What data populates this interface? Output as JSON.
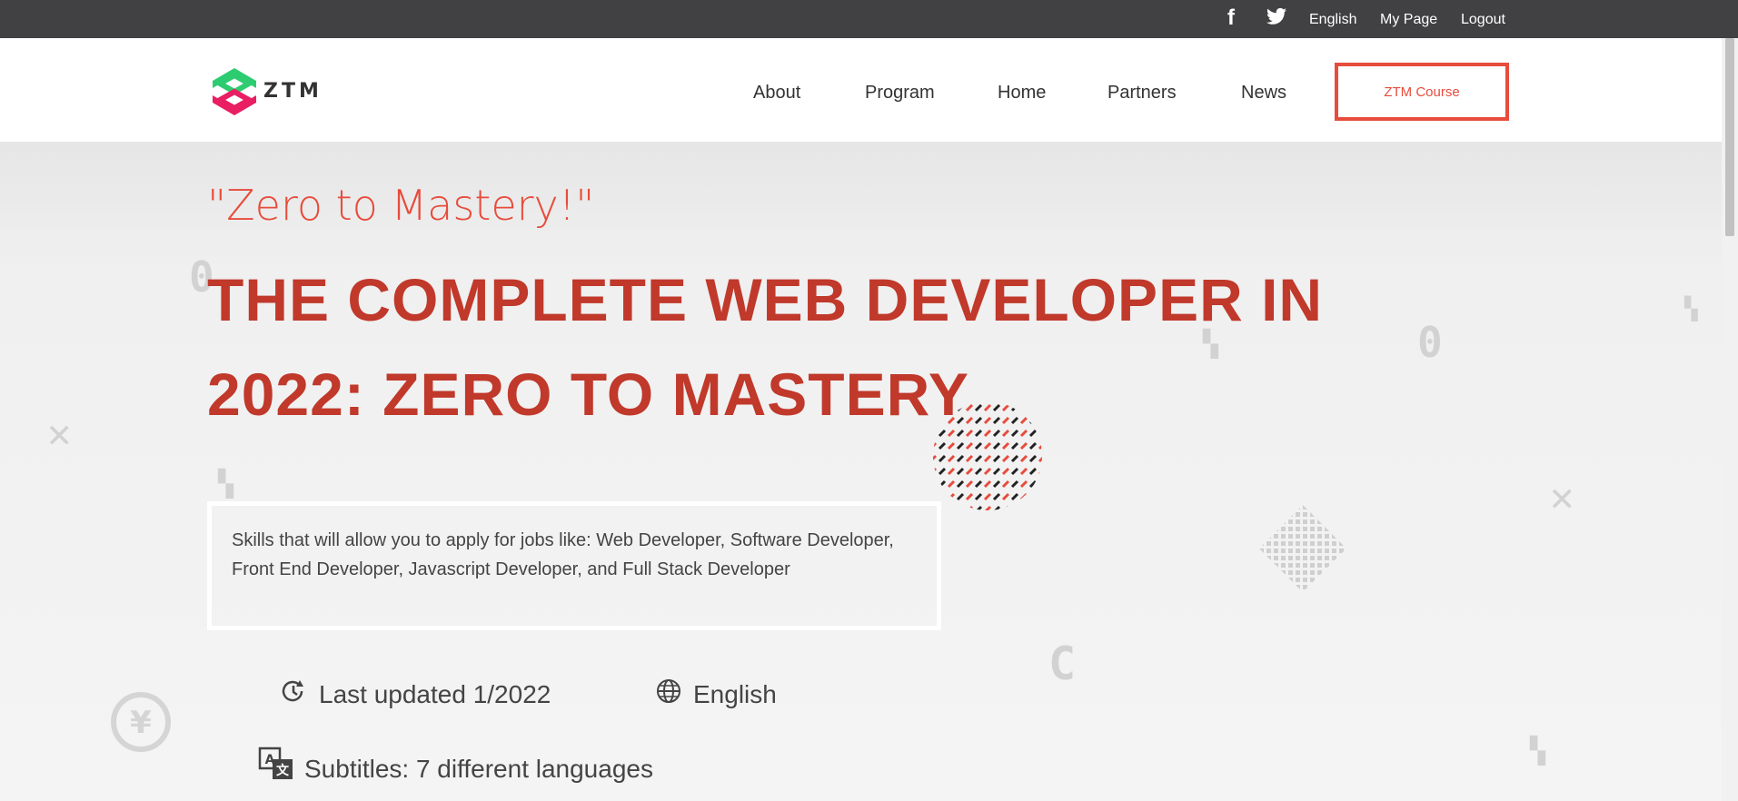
{
  "topbar": {
    "social": [
      {
        "icon": "facebook-icon",
        "glyph": "f"
      },
      {
        "icon": "twitter-icon",
        "glyph": "🐦"
      }
    ],
    "links": [
      "English",
      "My Page",
      "Logout"
    ]
  },
  "header": {
    "logo_text": "ZTM",
    "nav": [
      "About",
      "Program",
      "Home",
      "Partners",
      "News"
    ],
    "cta": "ZTM Course"
  },
  "hero": {
    "tagline": "\"Zero to Mastery!\"",
    "title_line1": "THE COMPLETE WEB DEVELOPER IN",
    "title_line2": "2022: ZERO TO MASTERY",
    "skills": "Skills that will allow you to apply for jobs like: Web Developer, Software Developer, Front End Developer, Javascript Developer, and Full Stack Developer",
    "last_updated": "Last updated 1/2022",
    "language": "English",
    "subtitles": "Subtitles: 7 different languages"
  },
  "colors": {
    "accent": "#e74c3c",
    "title": "#c0392b",
    "topbar": "#414143"
  }
}
